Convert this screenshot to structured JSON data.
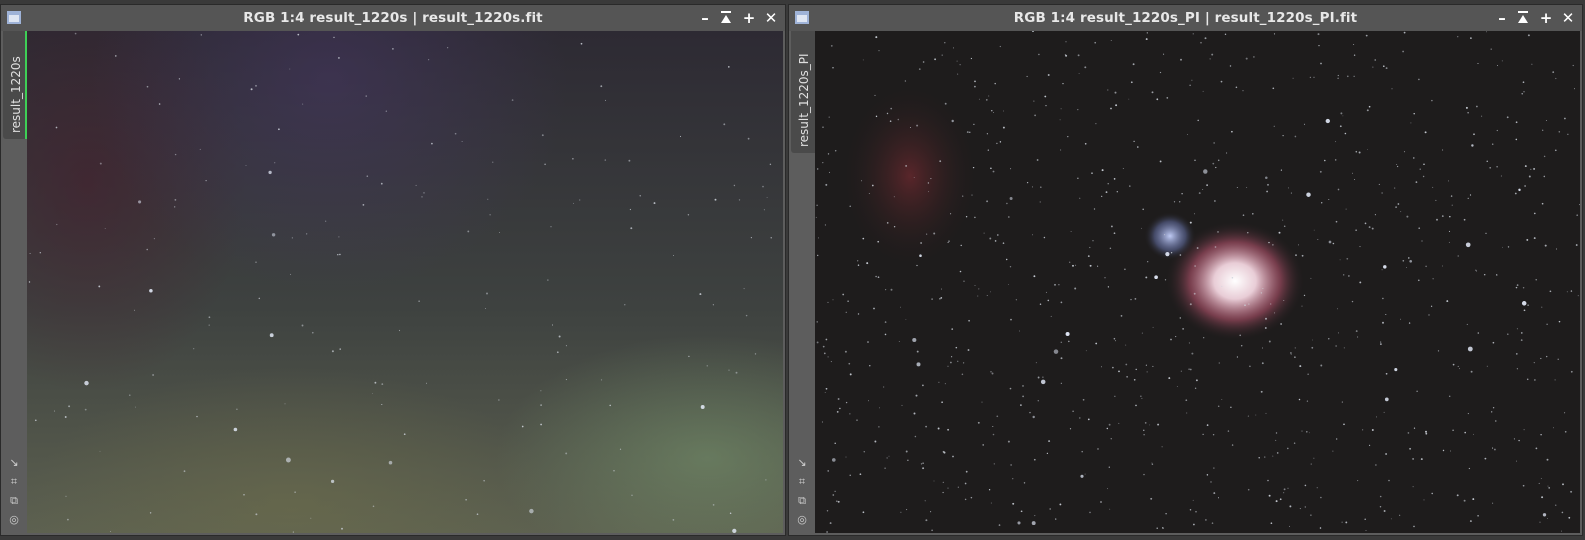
{
  "windows": [
    {
      "title": "RGB 1:4 result_1220s | result_1220s.fit",
      "tab_label": "result_1220s",
      "controls": [
        "minimize-icon",
        "shade-icon",
        "maximize-icon",
        "close-icon"
      ]
    },
    {
      "title": "RGB 1:4 result_1220s_PI | result_1220s_PI.fit",
      "tab_label": "result_1220s_PI",
      "controls": [
        "minimize-icon",
        "shade-icon",
        "maximize-icon",
        "close-icon"
      ]
    }
  ],
  "colors": {
    "titlebar": "#555555",
    "active_tab_accent": "#3ecf56",
    "nebula": "#e8c7d3"
  }
}
